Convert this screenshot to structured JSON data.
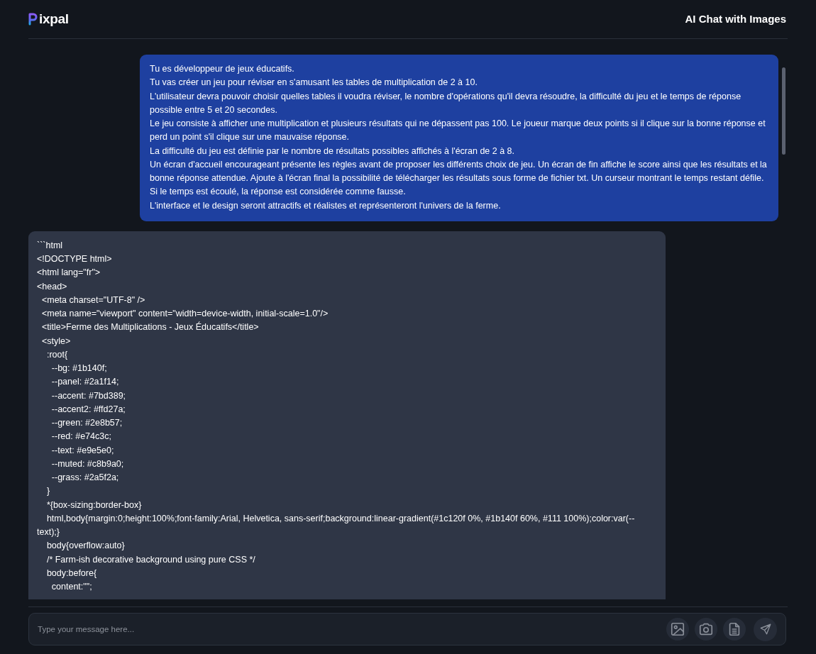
{
  "header": {
    "brand": "ixpal",
    "title": "AI Chat with Images"
  },
  "messages": [
    {
      "kind": "user",
      "lines": [
        "Tu es développeur de jeux éducatifs.",
        "Tu vas créer un jeu pour réviser en s'amusant les tables de multiplication de 2 à 10.",
        "L'utilisateur devra pouvoir choisir quelles tables il voudra réviser, le nombre d'opérations qu'il devra résoudre, la difficulté du jeu et le temps de réponse possible entre 5 et 20 secondes.",
        "Le jeu consiste à afficher une multiplication et plusieurs résultats qui ne dépassent pas 100. Le joueur marque deux points si il clique sur la bonne réponse et perd un point s'il clique sur une mauvaise réponse.",
        "La difficulté du jeu est définie par le nombre de résultats possibles affichés à l'écran de 2 à 8.",
        "Un écran d'accueil encourageant présente les règles avant de proposer les différents choix de jeu. Un écran de fin affiche le score ainsi que les résultats et la bonne réponse attendue. Ajoute à l'écran final la possibilité de télécharger les résultats sous forme de fichier txt. Un curseur montrant le temps restant défile. Si le temps est écoulé, la réponse est considérée comme fausse.",
        "L'interface et le design seront attractifs et réalistes et représenteront l'univers de la ferme."
      ]
    },
    {
      "kind": "assistant",
      "lines": [
        "```html",
        "<!DOCTYPE html>",
        "<html lang=\"fr\">",
        "<head>",
        "  <meta charset=\"UTF-8\" />",
        "  <meta name=\"viewport\" content=\"width=device-width, initial-scale=1.0\"/>",
        "  <title>Ferme des Multiplications - Jeux Éducatifs</title>",
        "  <style>",
        "    :root{",
        "      --bg: #1b140f;",
        "      --panel: #2a1f14;",
        "      --accent: #7bd389;",
        "      --accent2: #ffd27a;",
        "      --green: #2e8b57;",
        "      --red: #e74c3c;",
        "      --text: #e9e5e0;",
        "      --muted: #c8b9a0;",
        "      --grass: #2a5f2a;",
        "    }",
        "    *{box-sizing:border-box}",
        "    html,body{margin:0;height:100%;font-family:Arial, Helvetica, sans-serif;background:linear-gradient(#1c120f 0%, #1b140f 60%, #111 100%);color:var(--text);}",
        "    body{overflow:auto}",
        "    /* Farm-ish decorative background using pure CSS */",
        "    body:before{",
        "      content:\"\";"
      ]
    }
  ],
  "composer": {
    "placeholder": "Type your message here...",
    "buttons": [
      {
        "kind": "image"
      },
      {
        "kind": "camera"
      },
      {
        "kind": "document"
      },
      {
        "kind": "send"
      }
    ]
  }
}
